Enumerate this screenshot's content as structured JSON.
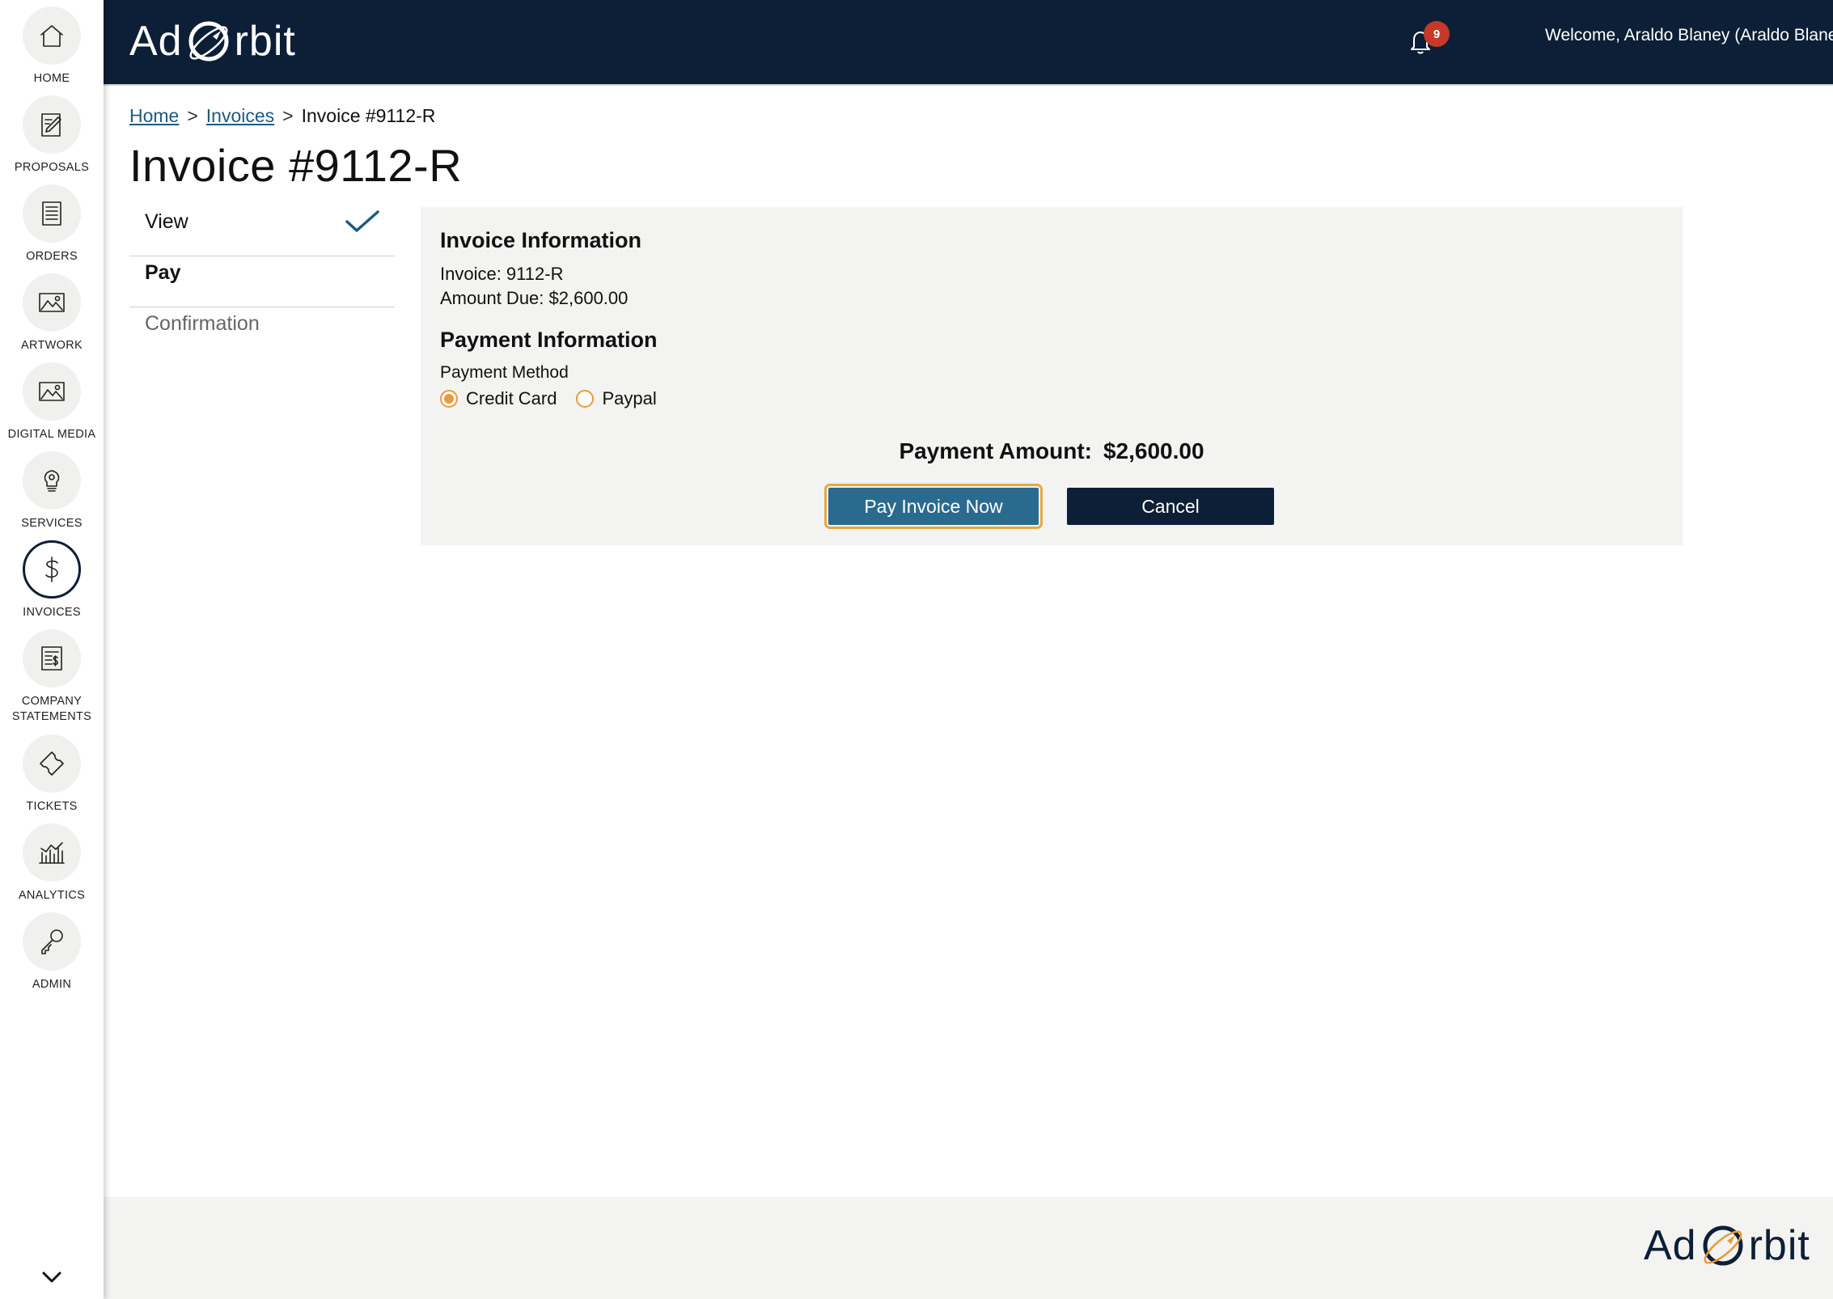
{
  "app": {
    "logo_prefix": "Ad",
    "logo_suffix": "rbit"
  },
  "colors": {
    "navy": "#0d1f36",
    "accent_orange": "#e89a3c",
    "link_blue": "#1d5a84",
    "primary_button": "#2b6a8f",
    "badge_red": "#c6382a"
  },
  "sidebar": {
    "items": [
      {
        "label": "HOME",
        "icon": "home-icon",
        "active": false
      },
      {
        "label": "PROPOSALS",
        "icon": "proposals-icon",
        "active": false
      },
      {
        "label": "ORDERS",
        "icon": "orders-icon",
        "active": false
      },
      {
        "label": "ARTWORK",
        "icon": "artwork-icon",
        "active": false
      },
      {
        "label": "DIGITAL MEDIA",
        "icon": "digital-media-icon",
        "active": false
      },
      {
        "label": "SERVICES",
        "icon": "services-icon",
        "active": false
      },
      {
        "label": "INVOICES",
        "icon": "invoices-icon",
        "active": true
      },
      {
        "label_line1": "COMPANY",
        "label_line2": "STATEMENTS",
        "icon": "company-statements-icon",
        "active": false
      },
      {
        "label": "TICKETS",
        "icon": "tickets-icon",
        "active": false
      },
      {
        "label": "ANALYTICS",
        "icon": "analytics-icon",
        "active": false
      },
      {
        "label": "ADMIN",
        "icon": "admin-icon",
        "active": false
      }
    ],
    "toggle_icon": "chevron-down-icon"
  },
  "header": {
    "notification_count": "9",
    "welcome_text": "Welcome, Araldo Blaney (Araldo Blaney Co.)"
  },
  "breadcrumb": {
    "home": "Home",
    "sep": ">",
    "invoices": "Invoices",
    "current": "Invoice #9112-R"
  },
  "page": {
    "title": "Invoice #9112-R"
  },
  "steps": [
    {
      "label": "View",
      "status": "done"
    },
    {
      "label": "Pay",
      "status": "current"
    },
    {
      "label": "Confirmation",
      "status": "pending"
    }
  ],
  "invoice_info": {
    "heading": "Invoice Information",
    "invoice_line": "Invoice: 9112-R",
    "amount_due_line": "Amount Due: $2,600.00"
  },
  "payment_info": {
    "heading": "Payment Information",
    "method_label": "Payment Method",
    "options": [
      {
        "label": "Credit Card",
        "selected": true
      },
      {
        "label": "Paypal",
        "selected": false
      }
    ],
    "amount_label": "Payment Amount:",
    "amount_value": "$2,600.00"
  },
  "actions": {
    "pay_label": "Pay Invoice Now",
    "cancel_label": "Cancel"
  }
}
